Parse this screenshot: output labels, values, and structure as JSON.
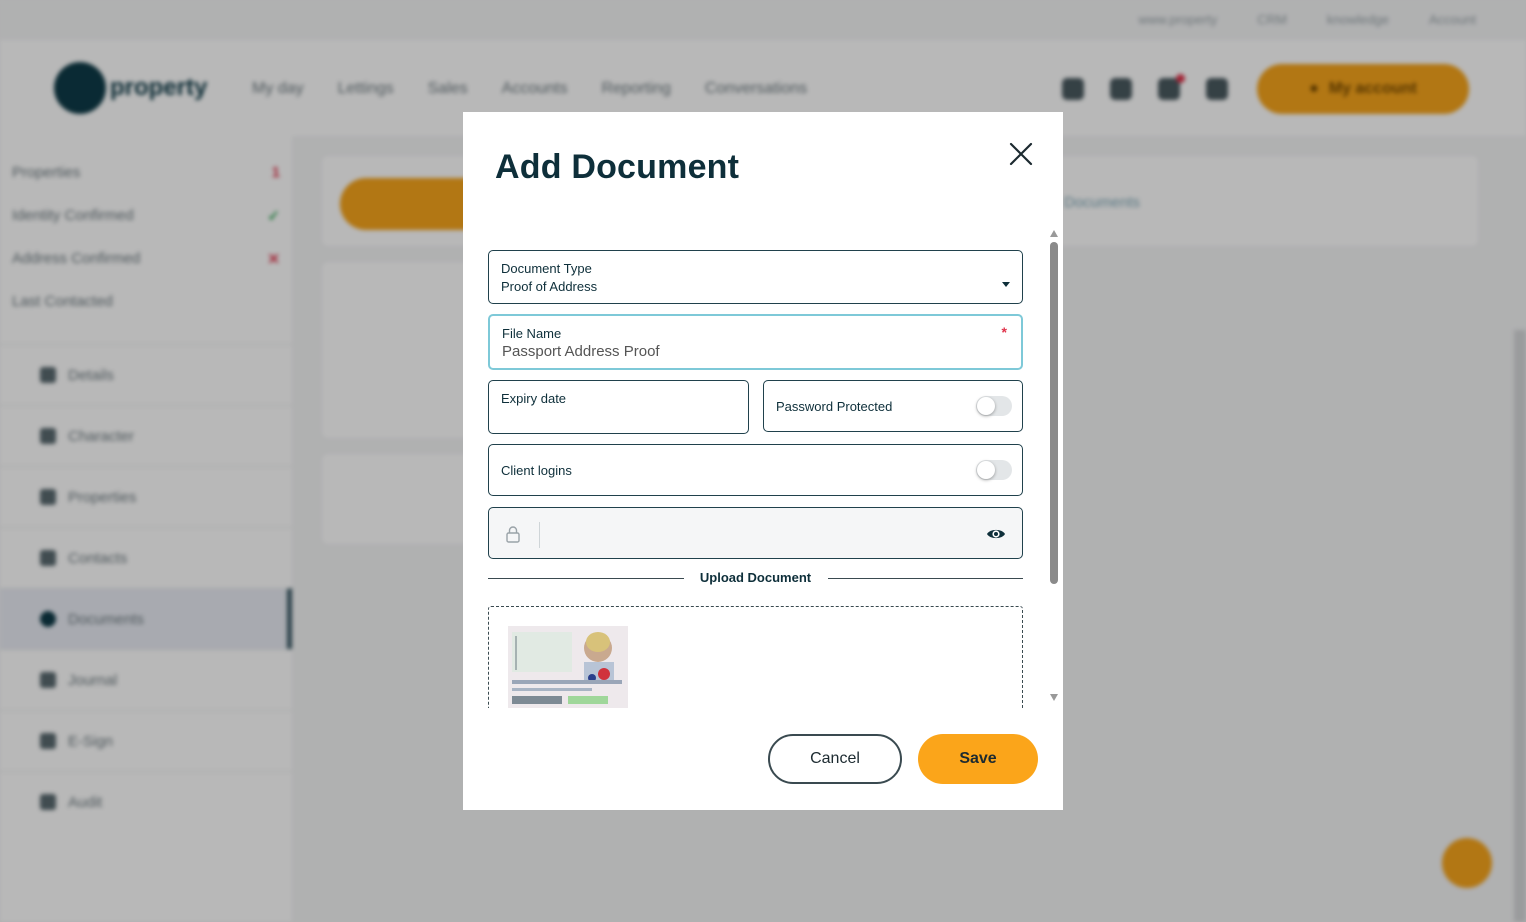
{
  "background": {
    "toplinks": [
      "www.property",
      "CRM",
      "knowledge",
      "Account"
    ],
    "logo_text": "property",
    "nav": [
      "My day",
      "Lettings",
      "Sales",
      "Accounts",
      "Reporting",
      "Conversations"
    ],
    "account_button": "My account",
    "side_stats": [
      {
        "label": "Properties",
        "mark": "1"
      },
      {
        "label": "Identity Confirmed",
        "mark": "✓"
      },
      {
        "label": "Address Confirmed",
        "mark": "✕"
      },
      {
        "label": "Last Contacted",
        "mark": ""
      }
    ],
    "side_menu": [
      "Details",
      "Character",
      "Properties",
      "Contacts",
      "Documents",
      "Journal",
      "E-Sign",
      "Audit"
    ],
    "active_menu": "Documents",
    "documents_link": "Documents"
  },
  "modal": {
    "title": "Add Document",
    "document_type": {
      "label": "Document Type",
      "value": "Proof of Address"
    },
    "file_name": {
      "label": "File Name",
      "value": "Passport Address Proof",
      "required_mark": "*"
    },
    "expiry_date": {
      "label": "Expiry date"
    },
    "password_protected": {
      "label": "Password Protected",
      "enabled": false
    },
    "client_logins": {
      "label": "Client logins",
      "enabled": false
    },
    "password": {
      "placeholder": ""
    },
    "upload_section_label": "Upload Document",
    "cancel_label": "Cancel",
    "save_label": "Save"
  },
  "colors": {
    "primary_dark": "#0e2f3a",
    "accent_orange": "#fba51a",
    "focus_border": "#7ec9d8",
    "required": "#e0334b"
  }
}
